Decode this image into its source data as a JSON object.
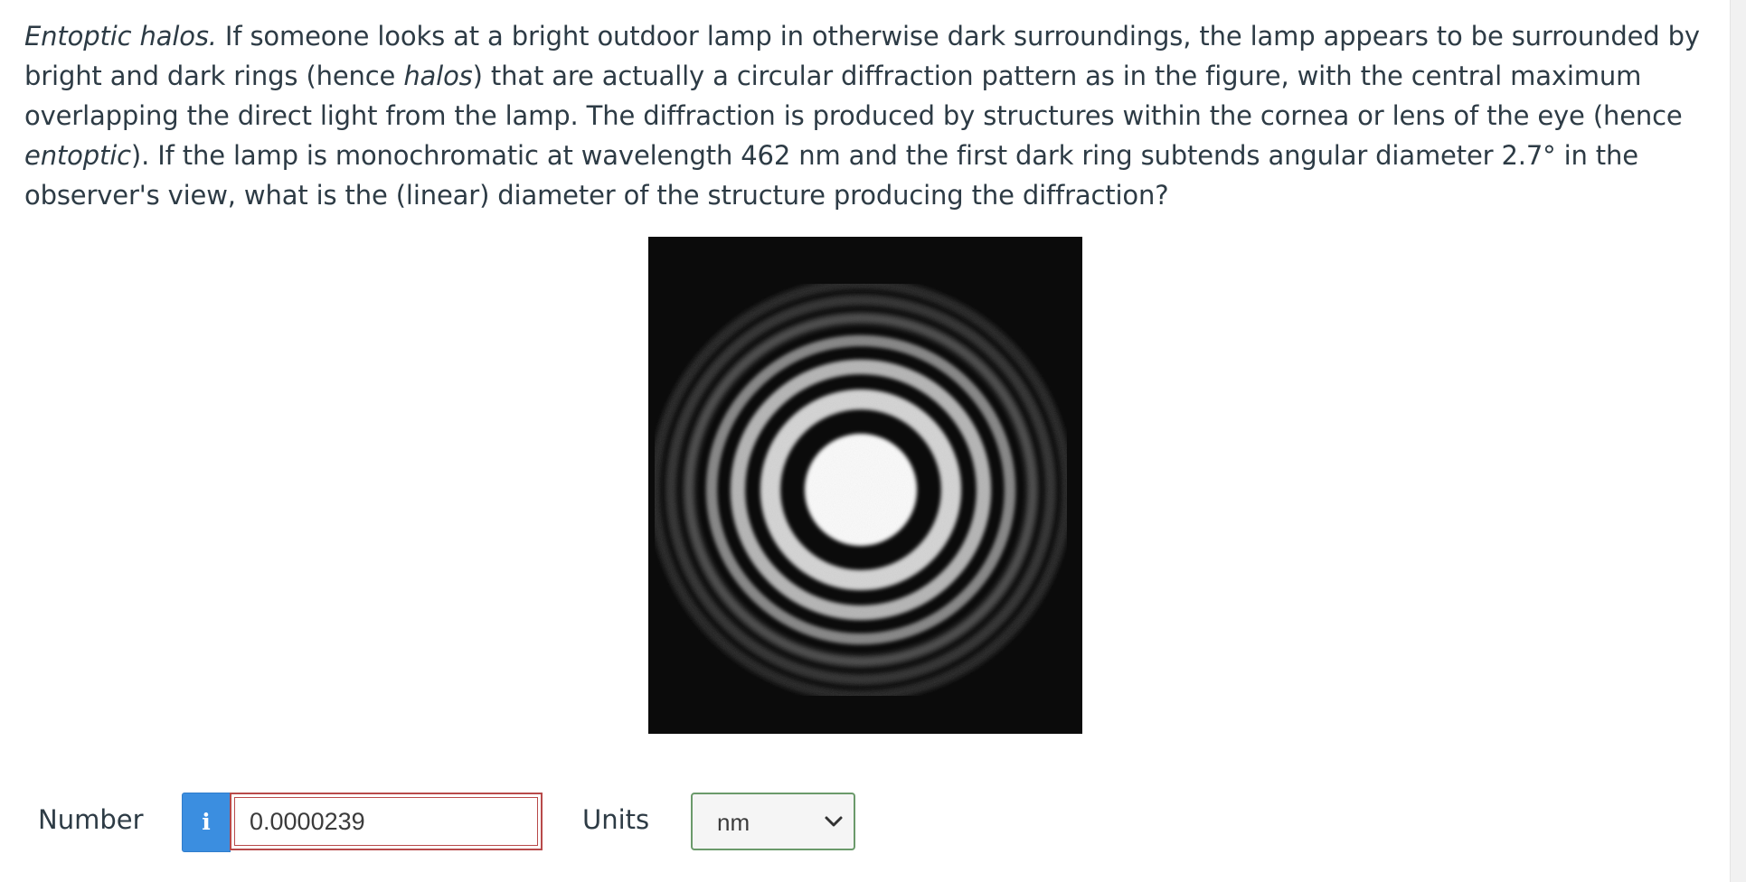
{
  "question": {
    "title_italic": "Entoptic halos.",
    "text_part1": " If someone looks at a bright outdoor lamp in otherwise dark surroundings, the lamp appears to be surrounded by bright and dark rings (hence ",
    "halos_italic": "halos",
    "text_part2": ") that are actually a circular diffraction pattern as in the figure, with the central maximum overlapping the direct light from the lamp. The diffraction is produced by structures within the cornea or lens of the eye (hence ",
    "entoptic_italic": "entoptic",
    "text_part3": "). If the lamp is monochromatic at wavelength 462 nm and the first dark ring subtends angular diameter 2.7° in the observer's view, what is the (linear) diameter of the structure producing the diffraction?"
  },
  "answer": {
    "number_label": "Number",
    "info_icon": "i",
    "number_value": "0.0000239",
    "units_label": "Units",
    "units_selected": "nm"
  },
  "colors": {
    "info_button": "#3b8ee0",
    "input_error_border": "#b84a4a",
    "select_border": "#6b9a6b",
    "text": "#2d3b45"
  }
}
